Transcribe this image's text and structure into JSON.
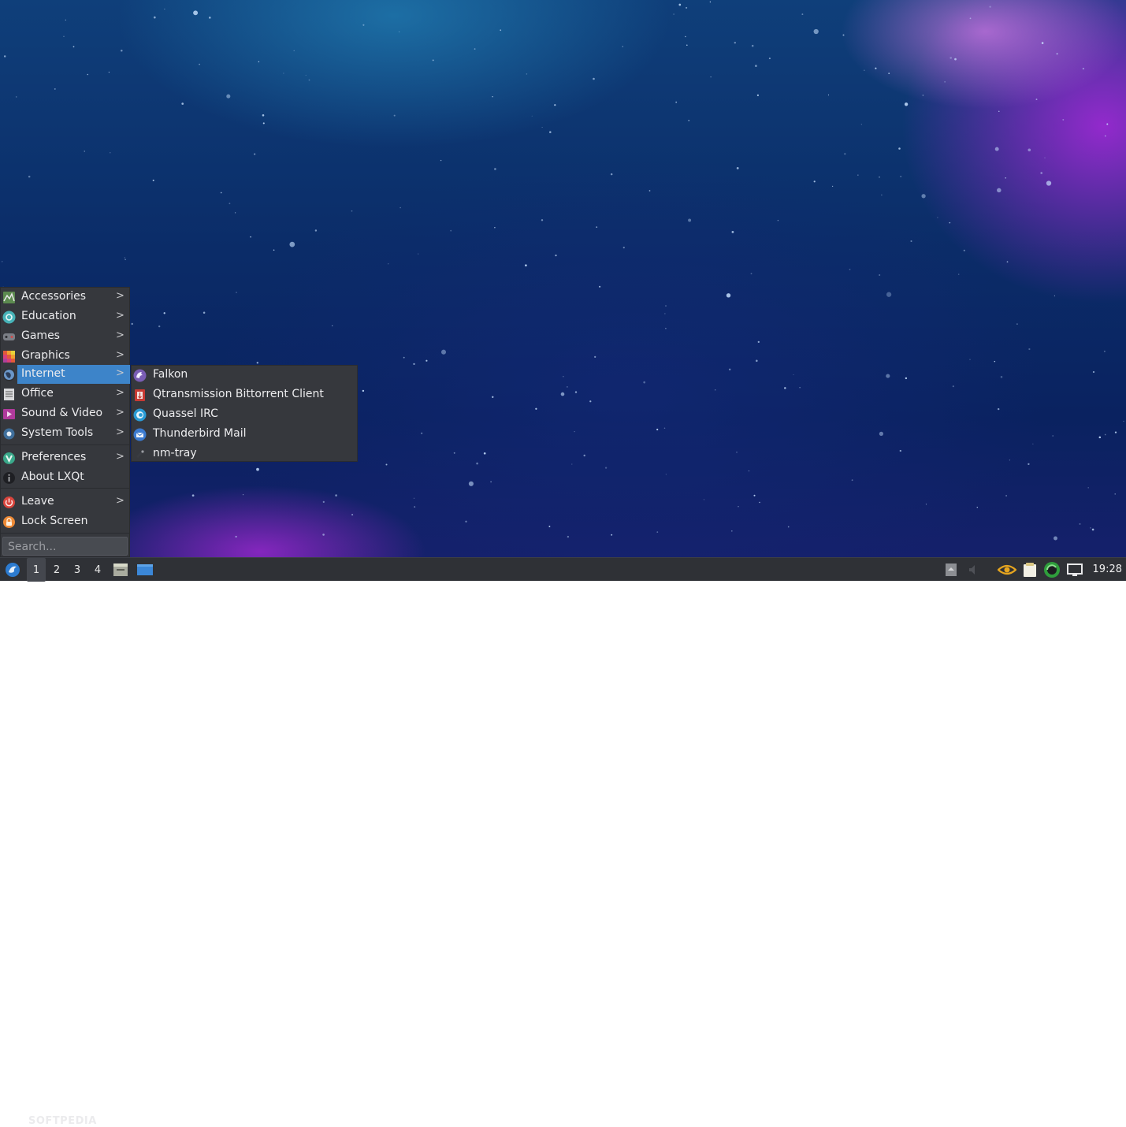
{
  "desktop": {
    "colors": {
      "top": "#0f3f7a",
      "bottom": "#15206b",
      "nebula": "#a82ad8"
    }
  },
  "main_menu": {
    "items": [
      {
        "label": "Accessories",
        "icon": "accessories-icon",
        "submenu": true
      },
      {
        "label": "Education",
        "icon": "education-icon",
        "submenu": true
      },
      {
        "label": "Games",
        "icon": "games-icon",
        "submenu": true
      },
      {
        "label": "Graphics",
        "icon": "graphics-icon",
        "submenu": true
      },
      {
        "label": "Internet",
        "icon": "internet-icon",
        "submenu": true,
        "selected": true
      },
      {
        "label": "Office",
        "icon": "office-icon",
        "submenu": true
      },
      {
        "label": "Sound & Video",
        "icon": "sound-video-icon",
        "submenu": true
      },
      {
        "label": "System Tools",
        "icon": "system-tools-icon",
        "submenu": true
      },
      {
        "label": "Preferences",
        "icon": "preferences-icon",
        "submenu": true
      },
      {
        "label": "About LXQt",
        "icon": "info-icon",
        "submenu": false
      },
      {
        "label": "Leave",
        "icon": "power-icon",
        "submenu": true
      },
      {
        "label": "Lock Screen",
        "icon": "lock-icon",
        "submenu": false
      }
    ],
    "arrow": ">",
    "search_placeholder": "Search...",
    "highlight_color": "#3d84c9"
  },
  "internet_submenu": {
    "items": [
      {
        "label": "Falkon",
        "icon": "falkon-icon"
      },
      {
        "label": "Qtransmission Bittorrent Client",
        "icon": "qtransmission-icon"
      },
      {
        "label": "Quassel IRC",
        "icon": "quassel-icon"
      },
      {
        "label": "Thunderbird Mail",
        "icon": "thunderbird-icon"
      },
      {
        "label": "nm-tray",
        "icon": "nm-tray-icon"
      }
    ]
  },
  "taskbar": {
    "desktops": [
      "1",
      "2",
      "3",
      "4"
    ],
    "active_desktop": "1",
    "clock": "19:28",
    "watermark": "SOFTPEDIA",
    "tray_icons": [
      "clipboard-icon",
      "volume-muted-icon",
      "eye-icon",
      "notes-icon",
      "update-icon",
      "display-icon"
    ]
  }
}
